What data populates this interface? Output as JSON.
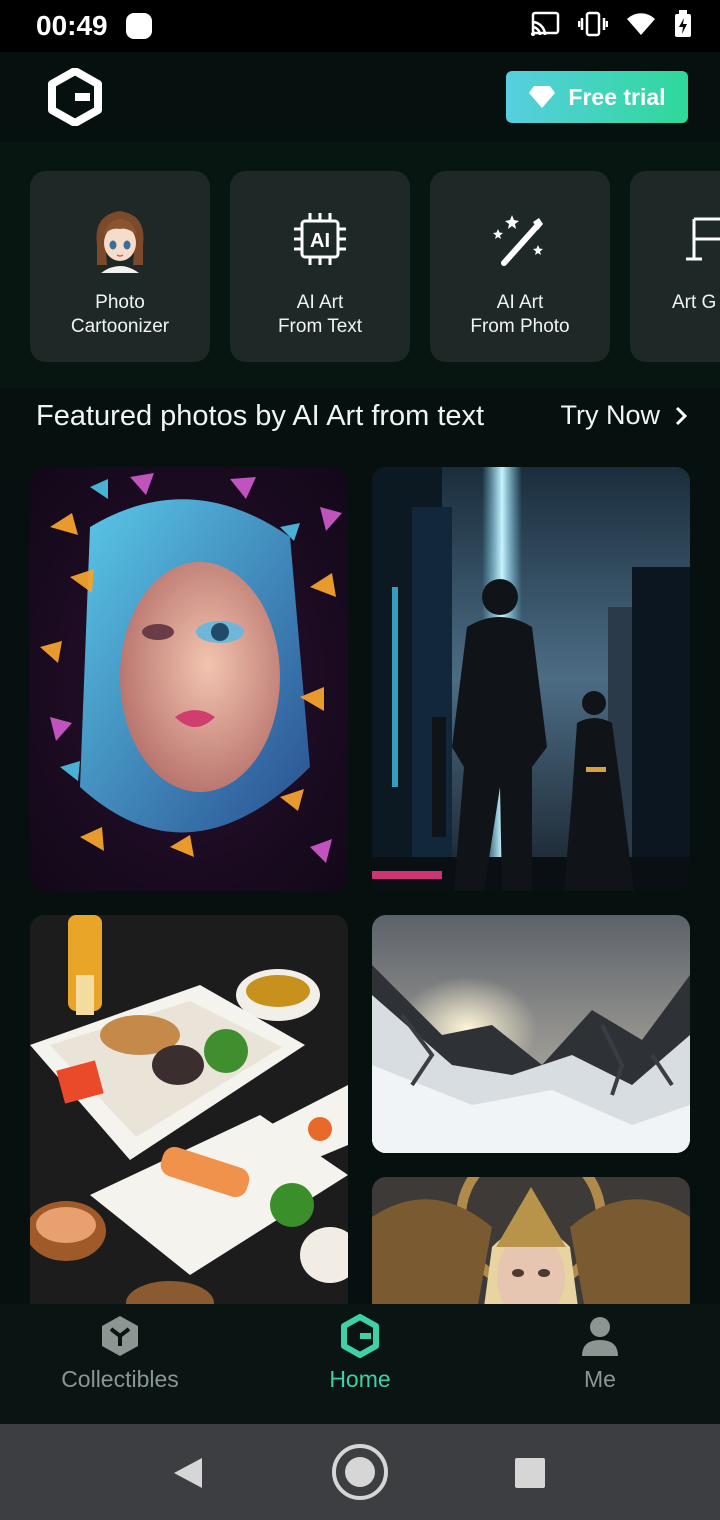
{
  "status_bar": {
    "time": "00:49"
  },
  "header": {
    "free_trial_label": "Free trial"
  },
  "tools": [
    {
      "label": "Photo\nCartoonizer",
      "icon": "anime-girl-icon"
    },
    {
      "label": "AI Art\nFrom Text",
      "icon": "ai-chip-icon"
    },
    {
      "label": "AI Art\nFrom Photo",
      "icon": "magic-wand-icon"
    },
    {
      "label": "Art G",
      "icon": "easel-icon"
    }
  ],
  "featured": {
    "title": "Featured photos by AI Art from text",
    "try_now": "Try Now"
  },
  "gallery": [
    "butterfly-portrait",
    "cyberpunk-warriors",
    "japanese-food",
    "snowy-mountains",
    "golden-queen"
  ],
  "bottom_nav": [
    {
      "label": "Collectibles",
      "active": false
    },
    {
      "label": "Home",
      "active": true
    },
    {
      "label": "Me",
      "active": false
    }
  ],
  "colors": {
    "accent": "#3ed0a6",
    "background": "#06110f",
    "card": "#1e2827"
  }
}
